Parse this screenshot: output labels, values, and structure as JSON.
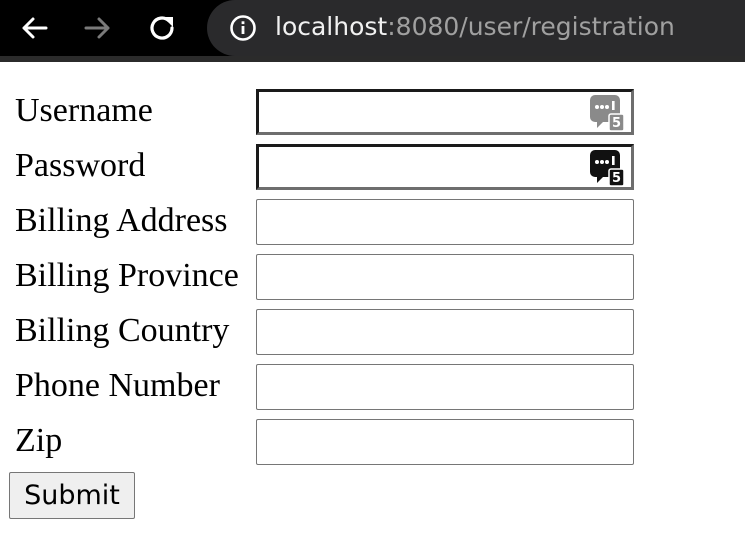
{
  "browser": {
    "url_host": "localhost",
    "url_path": ":8080/user/registration"
  },
  "form": {
    "fields": [
      {
        "label": "Username",
        "value": ""
      },
      {
        "label": "Password",
        "value": ""
      },
      {
        "label": "Billing Address",
        "value": ""
      },
      {
        "label": "Billing Province",
        "value": ""
      },
      {
        "label": "Billing Country",
        "value": ""
      },
      {
        "label": "Phone Number",
        "value": ""
      },
      {
        "label": "Zip",
        "value": ""
      }
    ],
    "submit_label": "Submit",
    "password_manager_badge": "5"
  },
  "colors": {
    "toolbar": "#000000",
    "omnibox": "#2a2a2c",
    "url_host": "#f1f1f1",
    "url_path": "#a0a0a0"
  }
}
